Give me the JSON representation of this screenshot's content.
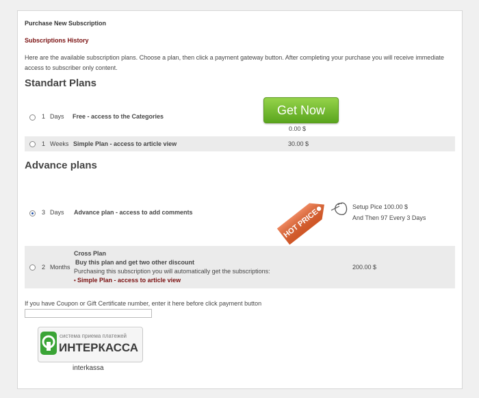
{
  "header": {
    "title": "Purchase New Subscription",
    "history_link": "Subscriptions History",
    "intro": "Here are the available subscription plans. Choose a plan, then click a payment gateway button. After completing your purchase you will receive immediate access to subscriber only content."
  },
  "standard": {
    "heading": "Standart Plans",
    "get_now": "Get Now",
    "plans": [
      {
        "selected": false,
        "qty": "1",
        "unit": "Days",
        "name": "Free - access to the Categories",
        "price": "0.00 $"
      },
      {
        "selected": false,
        "qty": "1",
        "unit": "Weeks",
        "name": "Simple Plan - access to article view",
        "price": "30.00 $"
      }
    ]
  },
  "advance": {
    "heading": "Advance plans",
    "hot_price_tag": "HOT PRICE",
    "plans": [
      {
        "selected": true,
        "qty": "3",
        "unit": "Days",
        "name": "Advance plan - access to add comments",
        "price_line1": "Setup Pice 100.00 $",
        "price_line2": "And Then 97 Every 3 Days"
      },
      {
        "selected": false,
        "qty": "2",
        "unit": "Months",
        "name": "Cross Plan",
        "subtitle": "Buy this plan and get two other discount",
        "note": "Purchasing this subscription you will automatically get the subscriptions:",
        "included": [
          "Simple Plan - access to article view"
        ],
        "price": "200.00 $"
      }
    ]
  },
  "coupon": {
    "label": "If you have Coupon or Gift Certificate number, enter it here before click payment button",
    "value": ""
  },
  "payment": {
    "logo_tagline": "система приема платежей",
    "logo_name": "ИНТЕРКАССА",
    "label": "interkassa",
    "colors": {
      "green": "#3aa436",
      "dark": "#3a3a3a"
    }
  },
  "colors": {
    "accent_red": "#7a1010",
    "get_now_green": "#6cb82c",
    "tag_orange": "#e8602a"
  }
}
